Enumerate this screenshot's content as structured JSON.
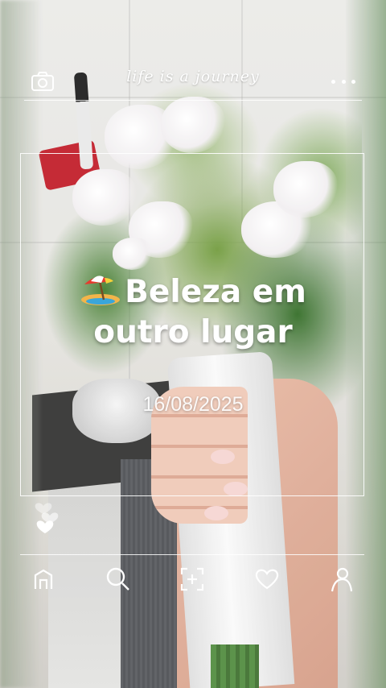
{
  "header": {
    "tagline": "life is a journey",
    "icons": {
      "left": "camera-icon",
      "right": "more-dots-icon"
    }
  },
  "post": {
    "emoji": "beach-umbrella",
    "title_line1": "Beleza em",
    "title_line2": "outro lugar",
    "date": "16/08/2025"
  },
  "reactions": {
    "icons": [
      "heart-outline-icon",
      "heart-outline-icon",
      "heart-filled-icon"
    ]
  },
  "navbar": {
    "items": [
      {
        "icon": "home-icon"
      },
      {
        "icon": "search-icon"
      },
      {
        "icon": "add-post-icon"
      },
      {
        "icon": "heart-icon"
      },
      {
        "icon": "profile-icon"
      }
    ]
  },
  "colors": {
    "overlay": "#ffffff",
    "leaf_green": "#3f7a2a",
    "pot_red": "#c01a25"
  }
}
